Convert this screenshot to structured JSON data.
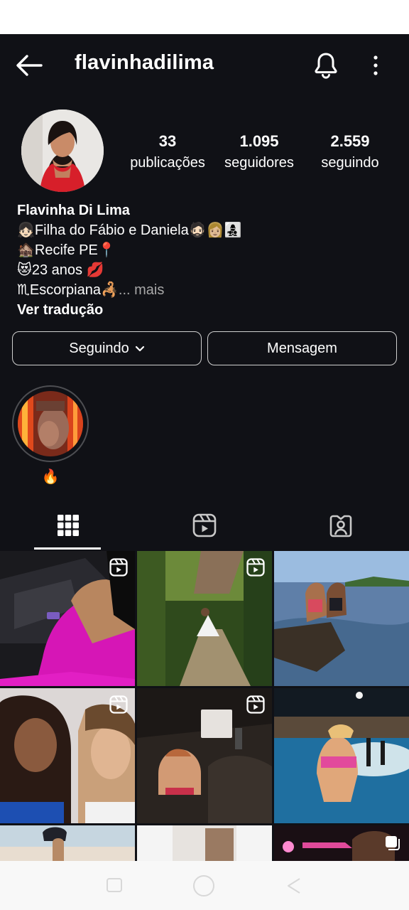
{
  "header": {
    "username": "flavinhadilima"
  },
  "stats": [
    {
      "value": "33",
      "label": "publicações"
    },
    {
      "value": "1.095",
      "label": "seguidores"
    },
    {
      "value": "2.559",
      "label": "seguindo"
    }
  ],
  "bio": {
    "name": "Flavinha Di Lima",
    "line1": "👧🏻Filha do Fábio e Daniela🧔🏻👩🏼👩‍👧‍👦",
    "line2": "🏚️Recife PE📍",
    "line3": "😻23 anos 💋",
    "line4": "♏Escorpiana🦂",
    "more": "... mais",
    "translate": "Ver tradução"
  },
  "actions": {
    "following": "Seguindo",
    "message": "Mensagem"
  },
  "highlights": [
    {
      "label": "🔥"
    }
  ],
  "colors": {
    "background": "#101116",
    "text": "#ffffff",
    "muted": "#a8a8a8"
  }
}
